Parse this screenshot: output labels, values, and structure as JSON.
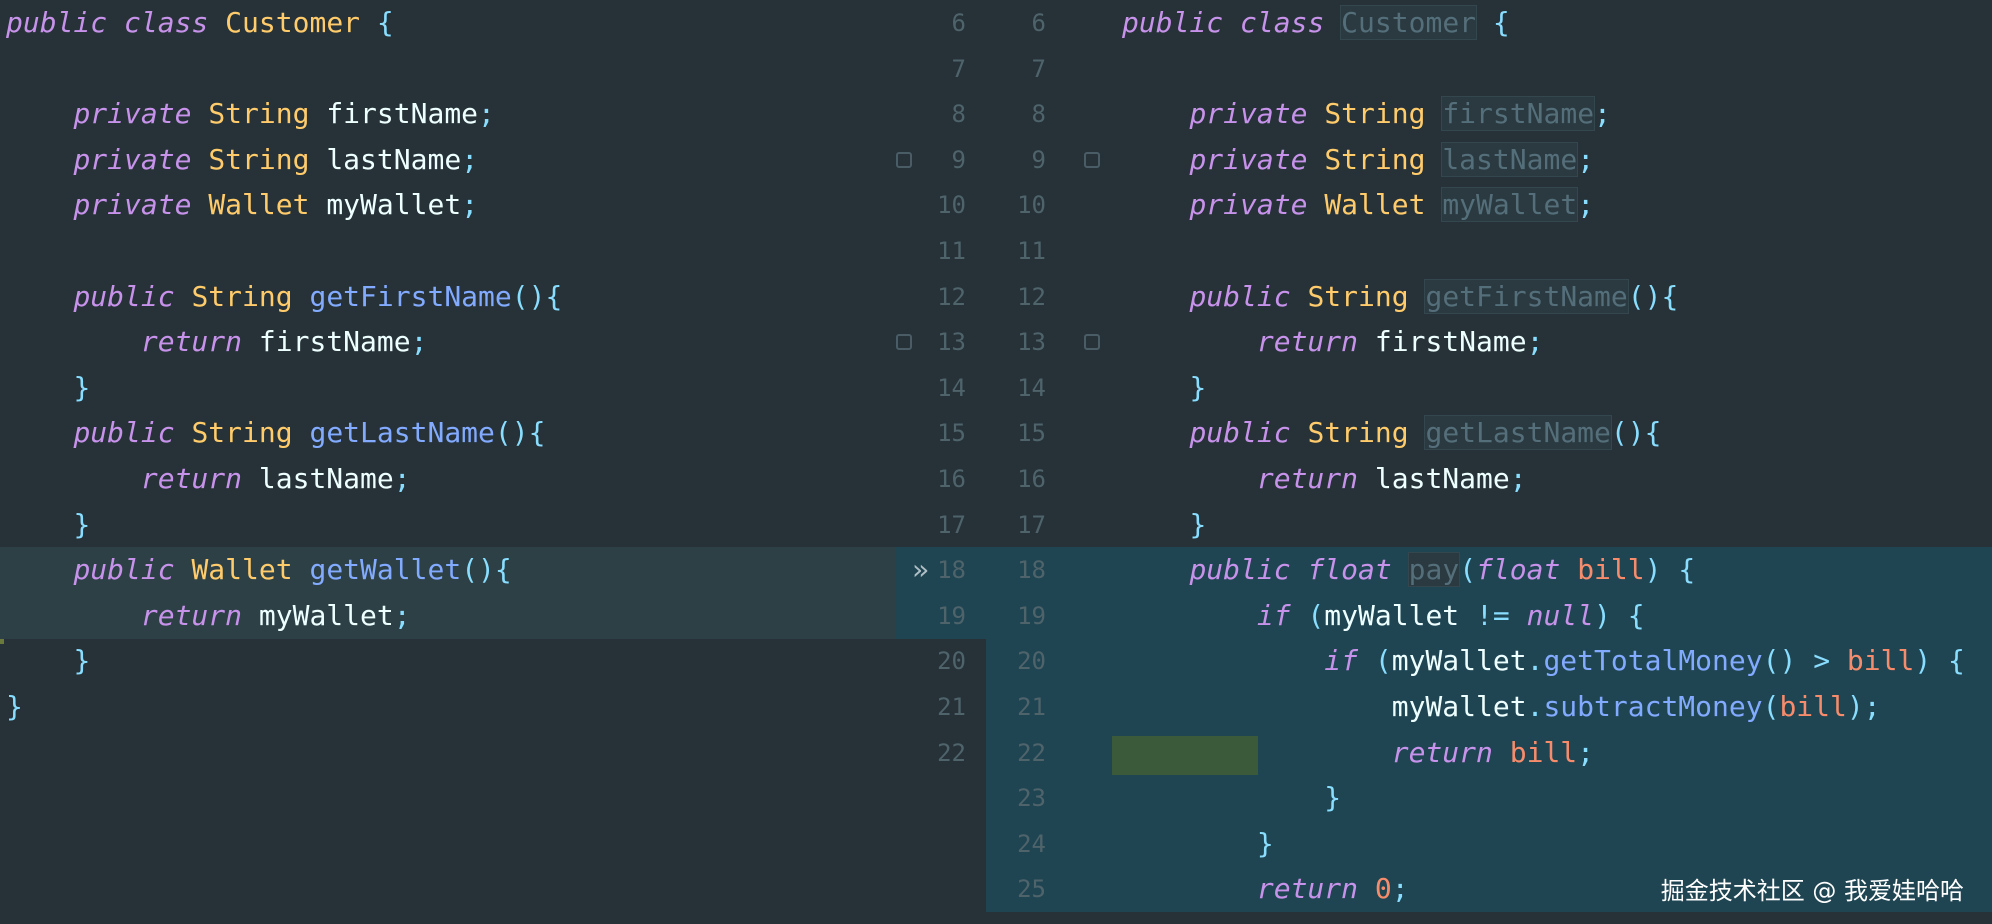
{
  "left": {
    "lines": [
      [
        {
          "c": "kw",
          "t": "public"
        },
        {
          "c": "id",
          "t": " "
        },
        {
          "c": "kw",
          "t": "class"
        },
        {
          "c": "id",
          "t": " "
        },
        {
          "c": "ty",
          "t": "Customer"
        },
        {
          "c": "id",
          "t": " "
        },
        {
          "c": "pu",
          "t": "{"
        }
      ],
      [],
      [
        {
          "c": "id",
          "t": "    "
        },
        {
          "c": "kw",
          "t": "private"
        },
        {
          "c": "id",
          "t": " "
        },
        {
          "c": "ty",
          "t": "String"
        },
        {
          "c": "id",
          "t": " firstName"
        },
        {
          "c": "pu",
          "t": ";"
        }
      ],
      [
        {
          "c": "id",
          "t": "    "
        },
        {
          "c": "kw",
          "t": "private"
        },
        {
          "c": "id",
          "t": " "
        },
        {
          "c": "ty",
          "t": "String"
        },
        {
          "c": "id",
          "t": " lastName"
        },
        {
          "c": "pu",
          "t": ";"
        }
      ],
      [
        {
          "c": "id",
          "t": "    "
        },
        {
          "c": "kw",
          "t": "private"
        },
        {
          "c": "id",
          "t": " "
        },
        {
          "c": "ty",
          "t": "Wallet"
        },
        {
          "c": "id",
          "t": " myWallet"
        },
        {
          "c": "pu",
          "t": ";"
        }
      ],
      [],
      [
        {
          "c": "id",
          "t": "    "
        },
        {
          "c": "kw",
          "t": "public"
        },
        {
          "c": "id",
          "t": " "
        },
        {
          "c": "ty",
          "t": "String"
        },
        {
          "c": "id",
          "t": " "
        },
        {
          "c": "fn",
          "t": "getFirstName"
        },
        {
          "c": "pu",
          "t": "(){"
        }
      ],
      [
        {
          "c": "id",
          "t": "        "
        },
        {
          "c": "kw",
          "t": "return"
        },
        {
          "c": "id",
          "t": " firstName"
        },
        {
          "c": "pu",
          "t": ";"
        }
      ],
      [
        {
          "c": "id",
          "t": "    "
        },
        {
          "c": "pu",
          "t": "}"
        }
      ],
      [
        {
          "c": "id",
          "t": "    "
        },
        {
          "c": "kw",
          "t": "public"
        },
        {
          "c": "id",
          "t": " "
        },
        {
          "c": "ty",
          "t": "String"
        },
        {
          "c": "id",
          "t": " "
        },
        {
          "c": "fn",
          "t": "getLastName"
        },
        {
          "c": "pu",
          "t": "(){"
        }
      ],
      [
        {
          "c": "id",
          "t": "        "
        },
        {
          "c": "kw",
          "t": "return"
        },
        {
          "c": "id",
          "t": " lastName"
        },
        {
          "c": "pu",
          "t": ";"
        }
      ],
      [
        {
          "c": "id",
          "t": "    "
        },
        {
          "c": "pu",
          "t": "}"
        }
      ],
      [
        {
          "c": "id",
          "t": "    "
        },
        {
          "c": "kw",
          "t": "public"
        },
        {
          "c": "id",
          "t": " "
        },
        {
          "c": "ty",
          "t": "Wallet"
        },
        {
          "c": "id",
          "t": " "
        },
        {
          "c": "fn",
          "t": "getWallet"
        },
        {
          "c": "pu",
          "t": "(){"
        }
      ],
      [
        {
          "c": "id",
          "t": "        "
        },
        {
          "c": "kw",
          "t": "return"
        },
        {
          "c": "id",
          "t": " myWallet"
        },
        {
          "c": "pu",
          "t": ";"
        }
      ],
      [
        {
          "c": "id",
          "t": "    "
        },
        {
          "c": "pu",
          "t": "}"
        }
      ],
      [
        {
          "c": "pu",
          "t": "}"
        }
      ]
    ]
  },
  "gutter": {
    "left_numbers": [
      "6",
      "7",
      "8",
      "9",
      "10",
      "11",
      "12",
      "13",
      "14",
      "15",
      "16",
      "17",
      "18",
      "19",
      "20",
      "21",
      "22"
    ],
    "right_numbers": [
      "6",
      "7",
      "8",
      "9",
      "10",
      "11",
      "12",
      "13",
      "14",
      "15",
      "16",
      "17",
      "18",
      "19",
      "20",
      "21",
      "22",
      "23",
      "24",
      "25"
    ],
    "arrow": "»"
  },
  "right": {
    "lines": [
      [
        {
          "c": "kw",
          "t": "public"
        },
        {
          "c": "id",
          "t": " "
        },
        {
          "c": "kw",
          "t": "class"
        },
        {
          "c": "id",
          "t": " "
        },
        {
          "c": "muted box",
          "t": "Customer"
        },
        {
          "c": "id",
          "t": " "
        },
        {
          "c": "pu",
          "t": "{"
        }
      ],
      [],
      [
        {
          "c": "id",
          "t": "    "
        },
        {
          "c": "kw",
          "t": "private"
        },
        {
          "c": "id",
          "t": " "
        },
        {
          "c": "ty",
          "t": "String"
        },
        {
          "c": "id",
          "t": " "
        },
        {
          "c": "muted box",
          "t": "firstName"
        },
        {
          "c": "pu",
          "t": ";"
        }
      ],
      [
        {
          "c": "id",
          "t": "    "
        },
        {
          "c": "kw",
          "t": "private"
        },
        {
          "c": "id",
          "t": " "
        },
        {
          "c": "ty",
          "t": "String"
        },
        {
          "c": "id",
          "t": " "
        },
        {
          "c": "muted box",
          "t": "lastName"
        },
        {
          "c": "pu",
          "t": ";"
        }
      ],
      [
        {
          "c": "id",
          "t": "    "
        },
        {
          "c": "kw",
          "t": "private"
        },
        {
          "c": "id",
          "t": " "
        },
        {
          "c": "ty",
          "t": "Wallet"
        },
        {
          "c": "id",
          "t": " "
        },
        {
          "c": "muted box",
          "t": "myWallet"
        },
        {
          "c": "pu",
          "t": ";"
        }
      ],
      [],
      [
        {
          "c": "id",
          "t": "    "
        },
        {
          "c": "kw",
          "t": "public"
        },
        {
          "c": "id",
          "t": " "
        },
        {
          "c": "ty",
          "t": "String"
        },
        {
          "c": "id",
          "t": " "
        },
        {
          "c": "muted box",
          "t": "getFirstName"
        },
        {
          "c": "pu",
          "t": "(){"
        }
      ],
      [
        {
          "c": "id",
          "t": "        "
        },
        {
          "c": "kw",
          "t": "return"
        },
        {
          "c": "id",
          "t": " firstName"
        },
        {
          "c": "pu",
          "t": ";"
        }
      ],
      [
        {
          "c": "id",
          "t": "    "
        },
        {
          "c": "pu",
          "t": "}"
        }
      ],
      [
        {
          "c": "id",
          "t": "    "
        },
        {
          "c": "kw",
          "t": "public"
        },
        {
          "c": "id",
          "t": " "
        },
        {
          "c": "ty",
          "t": "String"
        },
        {
          "c": "id",
          "t": " "
        },
        {
          "c": "muted box",
          "t": "getLastName"
        },
        {
          "c": "pu",
          "t": "(){"
        }
      ],
      [
        {
          "c": "id",
          "t": "        "
        },
        {
          "c": "kw",
          "t": "return"
        },
        {
          "c": "id",
          "t": " lastName"
        },
        {
          "c": "pu",
          "t": ";"
        }
      ],
      [
        {
          "c": "id",
          "t": "    "
        },
        {
          "c": "pu",
          "t": "}"
        }
      ],
      [
        {
          "c": "id",
          "t": "    "
        },
        {
          "c": "kw",
          "t": "public"
        },
        {
          "c": "id",
          "t": " "
        },
        {
          "c": "kw",
          "t": "float"
        },
        {
          "c": "id",
          "t": " "
        },
        {
          "c": "muted box",
          "t": "pay"
        },
        {
          "c": "pu",
          "t": "("
        },
        {
          "c": "kw",
          "t": "float"
        },
        {
          "c": "id",
          "t": " "
        },
        {
          "c": "nu",
          "t": "bill"
        },
        {
          "c": "pu",
          "t": ") {"
        }
      ],
      [
        {
          "c": "id",
          "t": "        "
        },
        {
          "c": "kw",
          "t": "if"
        },
        {
          "c": "pu",
          "t": " ("
        },
        {
          "c": "id",
          "t": "myWallet "
        },
        {
          "c": "op",
          "t": "!="
        },
        {
          "c": "id",
          "t": " "
        },
        {
          "c": "kw",
          "t": "null"
        },
        {
          "c": "pu",
          "t": ") {"
        }
      ],
      [
        {
          "c": "id",
          "t": "            "
        },
        {
          "c": "kw",
          "t": "if"
        },
        {
          "c": "pu",
          "t": " ("
        },
        {
          "c": "id",
          "t": "myWallet"
        },
        {
          "c": "pu",
          "t": "."
        },
        {
          "c": "fn",
          "t": "getTotalMoney"
        },
        {
          "c": "pu",
          "t": "()"
        },
        {
          "c": "id",
          "t": " "
        },
        {
          "c": "op",
          "t": ">"
        },
        {
          "c": "id",
          "t": " "
        },
        {
          "c": "nu",
          "t": "bill"
        },
        {
          "c": "pu",
          "t": ") {"
        }
      ],
      [
        {
          "c": "id",
          "t": "                myWallet"
        },
        {
          "c": "pu",
          "t": "."
        },
        {
          "c": "fn",
          "t": "subtractMoney"
        },
        {
          "c": "pu",
          "t": "("
        },
        {
          "c": "nu",
          "t": "bill"
        },
        {
          "c": "pu",
          "t": ");"
        }
      ],
      [
        {
          "c": "id",
          "t": "                "
        },
        {
          "c": "kw",
          "t": "return"
        },
        {
          "c": "id",
          "t": " "
        },
        {
          "c": "nu",
          "t": "bill"
        },
        {
          "c": "pu",
          "t": ";"
        }
      ],
      [
        {
          "c": "id",
          "t": "            "
        },
        {
          "c": "pu",
          "t": "}"
        }
      ],
      [
        {
          "c": "id",
          "t": "        "
        },
        {
          "c": "pu",
          "t": "}"
        }
      ],
      [
        {
          "c": "id",
          "t": "        "
        },
        {
          "c": "kw",
          "t": "return"
        },
        {
          "c": "id",
          "t": " "
        },
        {
          "c": "nu",
          "t": "0"
        },
        {
          "c": "pu",
          "t": ";"
        }
      ]
    ]
  },
  "watermark": "掘金技术社区 @ 我爱娃哈哈",
  "colors": {
    "background": "#263238",
    "keyword": "#c792ea",
    "type": "#ffcb6b",
    "function": "#82aaff",
    "punctuation": "#89ddff",
    "number": "#f78c6c",
    "diff_highlight": "#1f4553"
  }
}
